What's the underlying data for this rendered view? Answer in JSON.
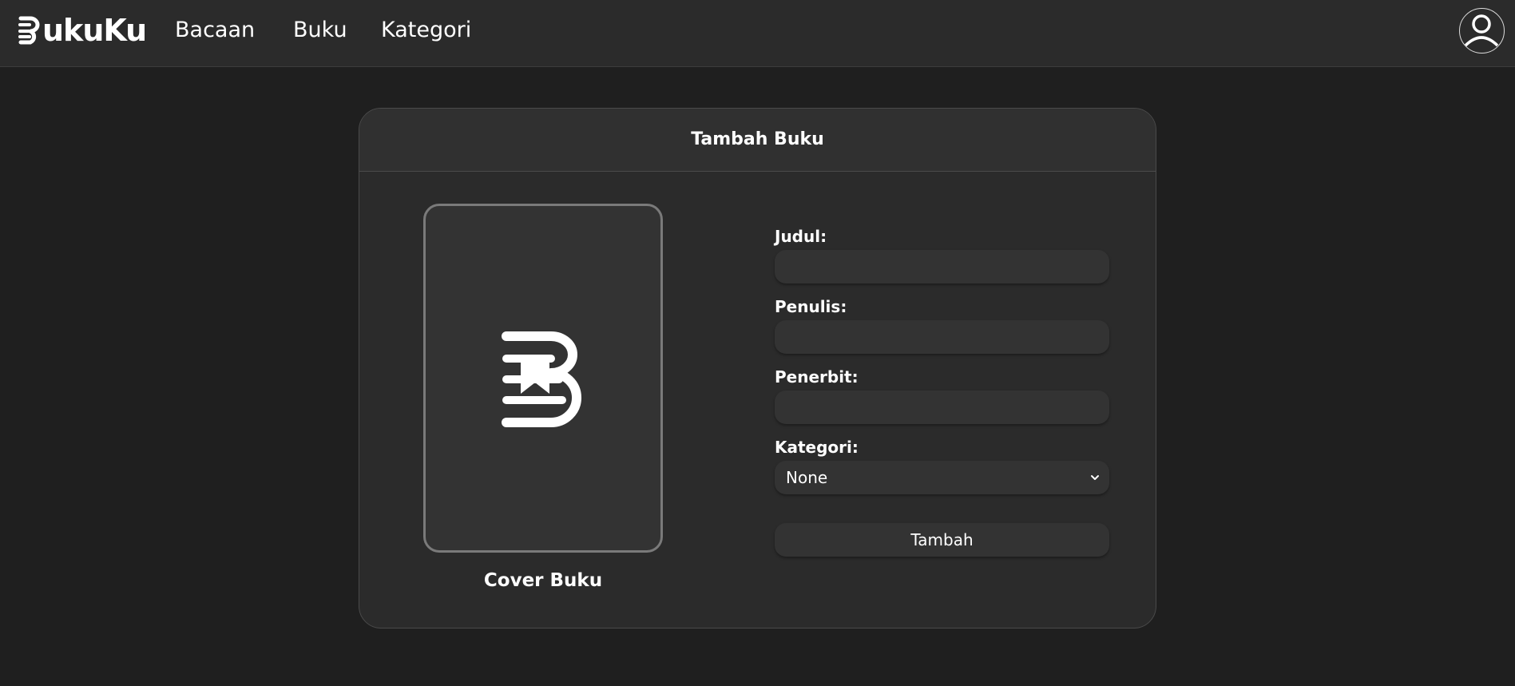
{
  "app": {
    "brand": "ukuKu",
    "nav": [
      {
        "label": "Bacaan"
      },
      {
        "label": "Buku"
      },
      {
        "label": "Kategori"
      }
    ]
  },
  "form": {
    "title": "Tambah Buku",
    "cover_label": "Cover Buku",
    "fields": {
      "judul": {
        "label": "Judul:",
        "value": ""
      },
      "penulis": {
        "label": "Penulis:",
        "value": ""
      },
      "penerbit": {
        "label": "Penerbit:",
        "value": ""
      },
      "kategori": {
        "label": "Kategori:",
        "selected": "None"
      }
    },
    "submit_label": "Tambah"
  },
  "icons": {
    "brand": "bukuku-logo-icon",
    "cover": "bukuku-b-bookmark-icon",
    "avatar": "user-avatar-icon",
    "chevron": "chevron-down-icon"
  },
  "colors": {
    "background": "#1f1f1f",
    "navbar": "#2b2b2b",
    "card": "#2b2b2b",
    "input": "#333333",
    "text": "#ffffff"
  }
}
